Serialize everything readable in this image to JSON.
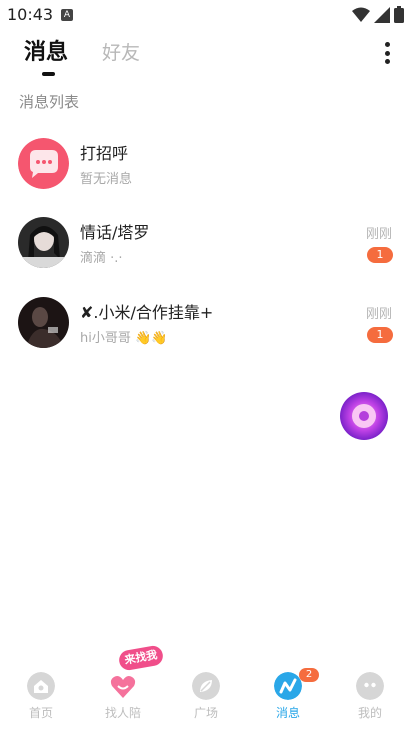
{
  "status_bar": {
    "time": "10:43",
    "notif_letter": "A"
  },
  "header": {
    "tabs": [
      {
        "label": "消息",
        "active": true
      },
      {
        "label": "好友",
        "active": false
      }
    ],
    "more_icon": "more-vertical-icon"
  },
  "section_title": "消息列表",
  "conversations": [
    {
      "name": "打招呼",
      "message": "暂无消息",
      "time": "",
      "unread": "",
      "avatar": "chat-bubble-icon"
    },
    {
      "name": "情话/塔罗",
      "message": "滴滴 ·.·",
      "time": "刚刚",
      "unread": "1",
      "avatar": "user-photo"
    },
    {
      "name": "✘.小米/合作挂靠+",
      "message": "hi小哥哥 👋👋",
      "time": "刚刚",
      "unread": "1",
      "avatar": "user-photo"
    }
  ],
  "floating_button": {
    "icon": "disc-icon"
  },
  "bottom_nav": {
    "find_tag": "来找我",
    "items": [
      {
        "label": "首页",
        "icon": "home-icon",
        "active": false,
        "badge": ""
      },
      {
        "label": "找人陪",
        "icon": "heart-icon",
        "active": false,
        "badge": ""
      },
      {
        "label": "广场",
        "icon": "leaf-icon",
        "active": false,
        "badge": ""
      },
      {
        "label": "消息",
        "icon": "message-icon",
        "active": true,
        "badge": "2"
      },
      {
        "label": "我的",
        "icon": "profile-icon",
        "active": false,
        "badge": ""
      }
    ]
  },
  "colors": {
    "accent": "#2aa7e8",
    "badge": "#f56c3e",
    "greeting": "#f5566f"
  }
}
